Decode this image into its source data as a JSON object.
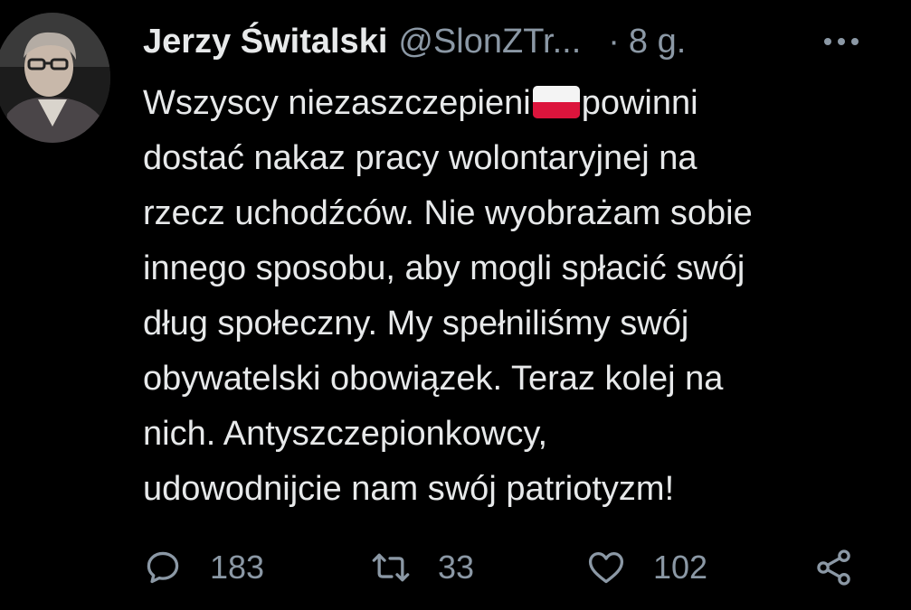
{
  "author": {
    "display_name": "Jerzy Świtalski",
    "handle": "@SlonZTr...",
    "separator": "·",
    "time_ago": "8 g."
  },
  "tweet": {
    "lines": [
      {
        "before_flag": "Wszyscy niezaszczepieni",
        "flag": "poland-flag-emoji",
        "after_flag": "powinni"
      },
      {
        "text": "dostać nakaz pracy wolontaryjnej na"
      },
      {
        "text": "rzecz uchodźców. Nie wyobrażam sobie"
      },
      {
        "text": "innego sposobu, aby mogli spłacić swój"
      },
      {
        "text": "dług społeczny. My spełniliśmy swój"
      },
      {
        "text": "obywatelski obowiązek. Teraz kolej na"
      },
      {
        "text": "nich. Antyszczepionkowcy,"
      },
      {
        "text": "udowodnijcie nam swój patriotyzm!"
      }
    ]
  },
  "actions": {
    "reply": {
      "icon": "reply-icon",
      "count": "183"
    },
    "retweet": {
      "icon": "retweet-icon",
      "count": "33"
    },
    "like": {
      "icon": "heart-icon",
      "count": "102"
    },
    "share": {
      "icon": "share-icon"
    }
  },
  "colors": {
    "background": "#000000",
    "text": "#e7e9ea",
    "secondary": "#8b98a5",
    "flag_white": "#f4f4f4",
    "flag_red": "#dc143c"
  }
}
